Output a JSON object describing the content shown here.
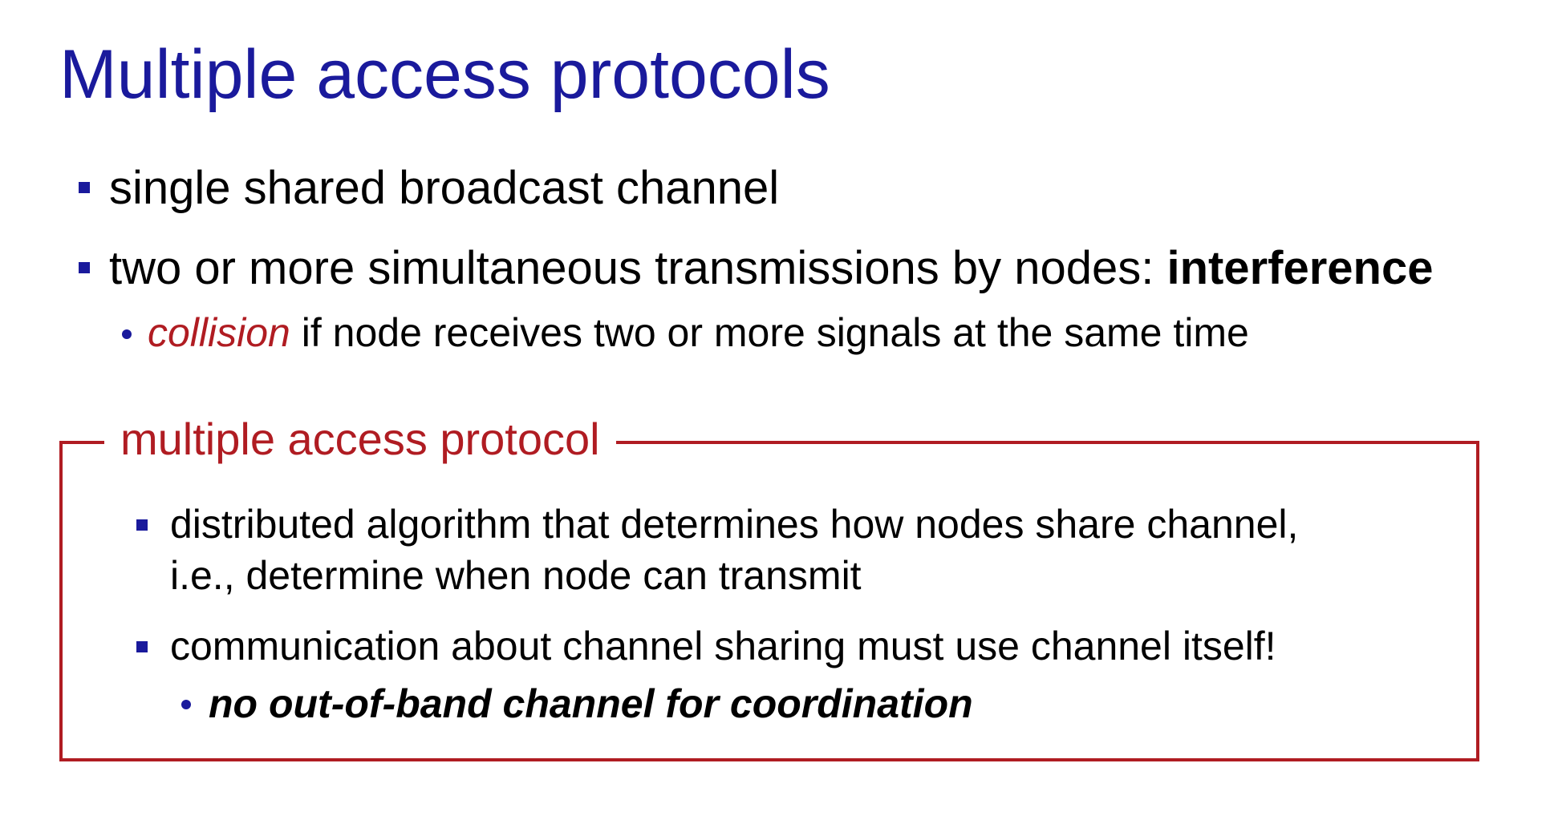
{
  "colors": {
    "title": "#1a1a9c",
    "bullet": "#1a1a9c",
    "accent_red": "#b01c22",
    "box_border": "#b01c22",
    "text": "#000000"
  },
  "slide": {
    "title": "Multiple access protocols",
    "bullets": [
      {
        "text": "single shared broadcast channel"
      },
      {
        "text": "two or more simultaneous transmissions by nodes: ",
        "bold_text": "interference"
      }
    ],
    "sub_bullet": {
      "italic_red": "collision",
      "rest": " if node receives two or more signals at the same time"
    }
  },
  "protocol_box": {
    "label": "multiple access protocol",
    "bullets": [
      {
        "line1": "distributed algorithm that determines how nodes share channel,",
        "line2": "i.e., determine when node can transmit"
      },
      {
        "line1": "communication about channel sharing must use channel itself!"
      }
    ],
    "sub_bullet": "no out-of-band channel for coordination"
  }
}
